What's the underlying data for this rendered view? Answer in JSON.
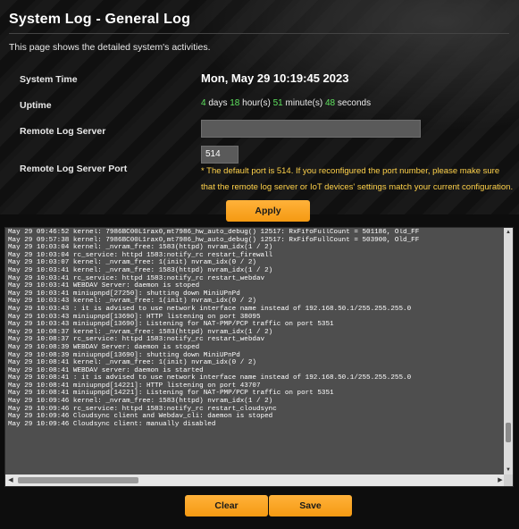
{
  "header": {
    "title": "System Log - General Log",
    "description": "This page shows the detailed system's activities."
  },
  "fields": {
    "system_time_label": "System Time",
    "system_time_value": "Mon, May 29 10:19:45 2023",
    "uptime_label": "Uptime",
    "uptime": {
      "days_num": "4",
      "days_text": " days ",
      "hours_num": "18",
      "hours_text": " hour(s) ",
      "minutes_num": "51",
      "minutes_text": " minute(s) ",
      "seconds_num": "48",
      "seconds_text": " seconds"
    },
    "remote_log_server_label": "Remote Log Server",
    "remote_log_server_value": "",
    "remote_log_port_label": "Remote Log Server Port",
    "remote_log_port_value": "514",
    "port_note": "* The default port is 514. If you reconfigured the port number, please make sure that the remote log server or IoT devices' settings match your current configuration."
  },
  "buttons": {
    "apply": "Apply",
    "clear": "Clear",
    "save": "Save"
  },
  "log": {
    "lines": [
      "May 29 09:46:52 kernel: 7986BC00L1rax0,mt7986_hw_auto_debug() 12517: RxFifoFullCount = 501186, Old_FF",
      "May 29 09:57:38 kernel: 7986BC00L1rax0,mt7986_hw_auto_debug() 12517: RxFifoFullCount = 503900, Old_FF",
      "May 29 10:03:04 kernel: _nvram_free: 1583(httpd) nvram_idx(1 / 2)",
      "May 29 10:03:04 rc_service: httpd 1583:notify_rc restart_firewall",
      "May 29 10:03:07 kernel: _nvram_free: 1(init) nvram_idx(0 / 2)",
      "May 29 10:03:41 kernel: _nvram_free: 1583(httpd) nvram_idx(1 / 2)",
      "May 29 10:03:41 rc_service: httpd 1583:notify_rc restart_webdav",
      "May 29 10:03:41 WEBDAV Server: daemon is stoped",
      "May 29 10:03:41 miniupnpd[27250]: shutting down MiniUPnPd",
      "May 29 10:03:43 kernel: _nvram_free: 1(init) nvram_idx(0 / 2)",
      "May 29 10:03:43 : it is advised to use network interface name instead of 192.168.50.1/255.255.255.0",
      "May 29 10:03:43 miniupnpd[13690]: HTTP listening on port 38095",
      "May 29 10:03:43 miniupnpd[13690]: Listening for NAT-PMP/PCP traffic on port 5351",
      "May 29 10:08:37 kernel: _nvram_free: 1583(httpd) nvram_idx(1 / 2)",
      "May 29 10:08:37 rc_service: httpd 1583:notify_rc restart_webdav",
      "May 29 10:08:39 WEBDAV Server: daemon is stoped",
      "May 29 10:08:39 miniupnpd[13690]: shutting down MiniUPnPd",
      "May 29 10:08:41 kernel: _nvram_free: 1(init) nvram_idx(0 / 2)",
      "May 29 10:08:41 WEBDAV server: daemon is started",
      "May 29 10:08:41 : it is advised to use network interface name instead of 192.168.50.1/255.255.255.0",
      "May 29 10:08:41 miniupnpd[14221]: HTTP listening on port 43707",
      "May 29 10:08:41 miniupnpd[14221]: Listening for NAT-PMP/PCP traffic on port 5351",
      "May 29 10:09:46 kernel: _nvram_free: 1583(httpd) nvram_idx(1 / 2)",
      "May 29 10:09:46 rc_service: httpd 1583:notify_rc restart_cloudsync",
      "May 29 10:09:46 Cloudsync client and Webdav_cli: daemon is stoped",
      "May 29 10:09:46 Cloudsync client: manually disabled"
    ]
  },
  "colors": {
    "accent": "#f59a12",
    "highlight_number": "#5fe35f",
    "note": "#ffd24a"
  }
}
